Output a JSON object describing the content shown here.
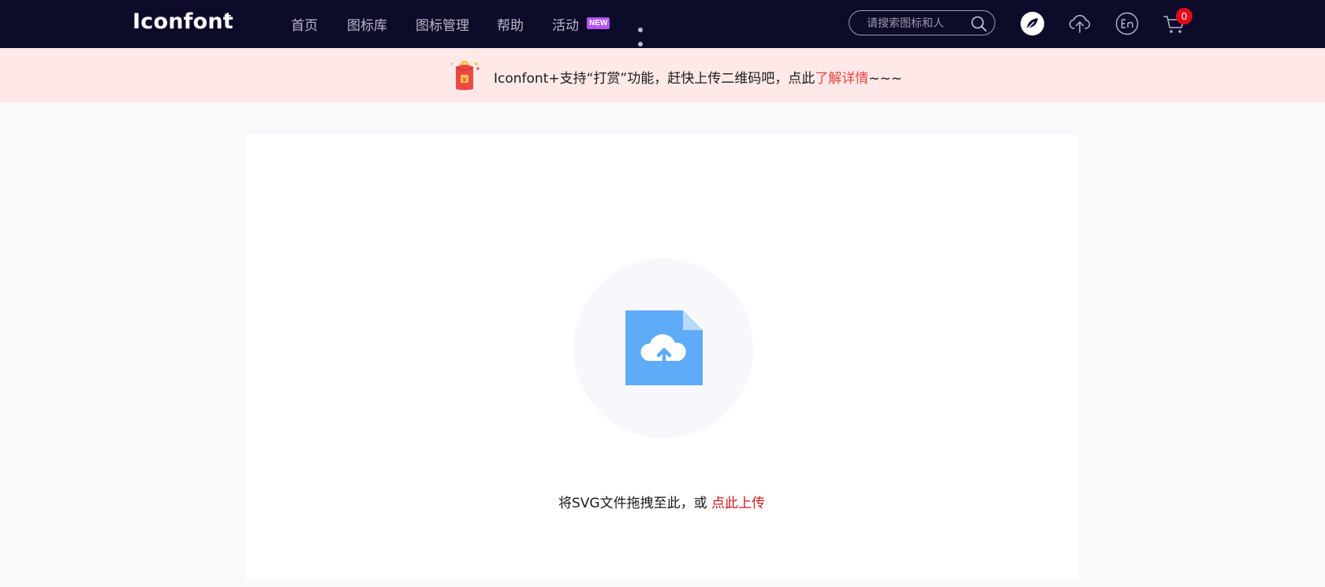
{
  "header": {
    "logo": "Iconfont",
    "logo_mark": "+",
    "nav": [
      {
        "label": "首页"
      },
      {
        "label": "图标库"
      },
      {
        "label": "图标管理"
      },
      {
        "label": "帮助"
      },
      {
        "label": "活动"
      }
    ],
    "new_badge": "NEW",
    "search_placeholder": "请搜索图标和人",
    "cart_count": "0",
    "icons": [
      "leaf-icon",
      "upload-cloud-icon",
      "language-en-icon",
      "cart-icon",
      "more-dots-icon",
      "search-icon"
    ]
  },
  "notice": {
    "text_before": "Iconfont+支持“打赏”功能，赶快上传二维码吧，点此",
    "link_text": "了解详情",
    "text_after": "~~~",
    "icon": "red-envelope-icon"
  },
  "upload": {
    "prompt": "将SVG文件拖拽至此，或 ",
    "link_text": "点此上传",
    "icon": "file-upload-icon"
  },
  "colors": {
    "header_bg": "#0d0b2a",
    "notice_bg": "#ffe8e8",
    "accent_red": "#d4141c",
    "notice_link": "#e8473f",
    "file_blue": "#5eabf7"
  }
}
